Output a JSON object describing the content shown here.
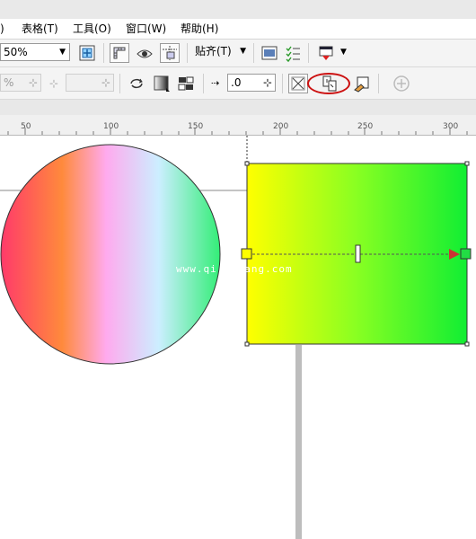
{
  "menubar": {
    "items": [
      {
        "label": ")"
      },
      {
        "label": "表格(T)"
      },
      {
        "label": "工具(O)"
      },
      {
        "label": "窗口(W)"
      },
      {
        "label": "帮助(H)"
      }
    ]
  },
  "toolbar1": {
    "zoom_value": "50%",
    "snap_label": "贴齐(T)"
  },
  "toolbar2": {
    "percent_value": "%",
    "step_value": ".0"
  },
  "ruler": {
    "labels": [
      "50",
      "100",
      "150",
      "200",
      "250",
      "300"
    ]
  },
  "canvas": {
    "watermark": "www.qi    ang.com",
    "circle_gradient": [
      "#ff3a6a",
      "#ff8a3c",
      "#ffaaee",
      "#cceeff",
      "#33ee77"
    ],
    "rect_gradient": [
      "#ffff00",
      "#88ff22",
      "#11ee33"
    ]
  },
  "colors": {
    "highlight_circle": "#cc1111",
    "arrow_color": "#cc3333"
  }
}
